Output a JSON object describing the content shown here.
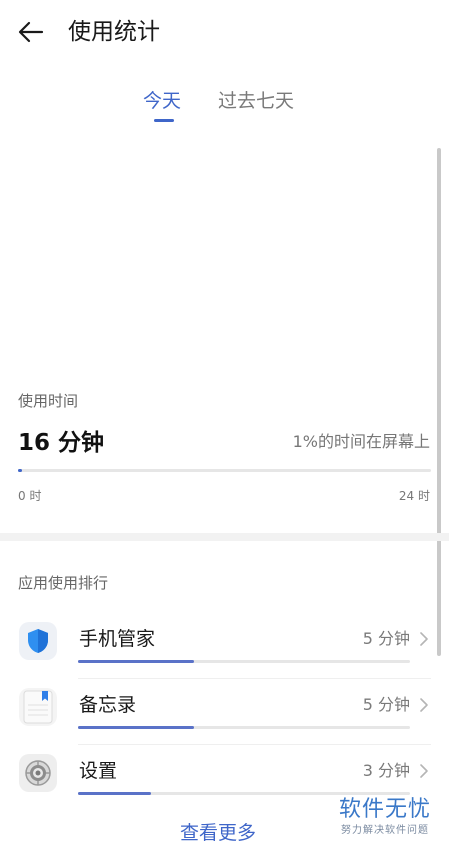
{
  "header": {
    "title": "使用统计"
  },
  "tabs": [
    {
      "label": "今天",
      "active": true
    },
    {
      "label": "过去七天",
      "active": false
    }
  ],
  "usage": {
    "label": "使用时间",
    "value": "16 分钟",
    "percent_text": "1%的时间在屏幕上",
    "progress_fraction": 0.01,
    "axis_start": "0 时",
    "axis_end": "24 时"
  },
  "ranking": {
    "title": "应用使用排行",
    "apps": [
      {
        "name": "手机管家",
        "time": "5 分钟",
        "icon": "phone-manager-shield-icon",
        "fraction": 0.35
      },
      {
        "name": "备忘录",
        "time": "5 分钟",
        "icon": "notepad-icon",
        "fraction": 0.35
      },
      {
        "name": "设置",
        "time": "3 分钟",
        "icon": "settings-gear-icon",
        "fraction": 0.22
      }
    ],
    "see_more": "查看更多"
  },
  "watermark": {
    "main": "软件无忧",
    "sub": "努力解决软件问题"
  },
  "colors": {
    "accent": "#3f66c9",
    "bar_fill": "#5a72c8",
    "track": "#e6e6e6",
    "watermark": "#3a78c8"
  }
}
